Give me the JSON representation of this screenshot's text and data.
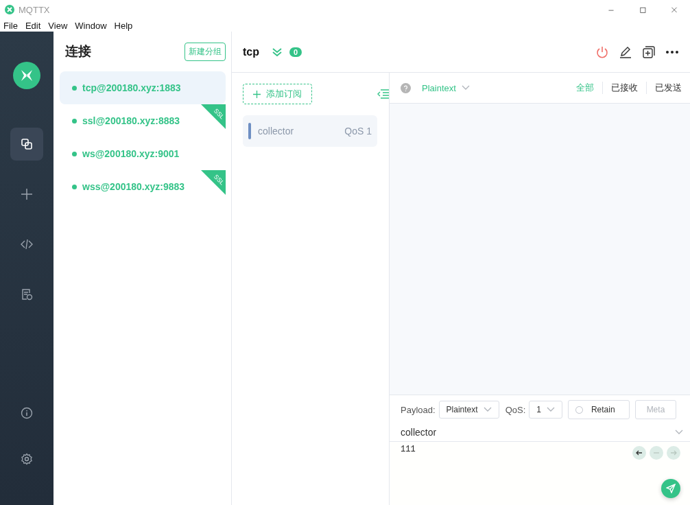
{
  "window": {
    "title": "MQTTX"
  },
  "menu": [
    "File",
    "Edit",
    "View",
    "Window",
    "Help"
  ],
  "nav": [
    {
      "selected": true
    },
    {
      "selected": false
    },
    {
      "selected": false
    },
    {
      "selected": false
    }
  ],
  "connections": {
    "title": "连接",
    "new_group_button": "新建分组",
    "items": [
      {
        "name": "tcp@200180.xyz:1883",
        "selected": true
      },
      {
        "name": "ssl@200180.xyz:8883",
        "selected": false,
        "badge": "SSL"
      },
      {
        "name": "ws@200180.xyz:9001",
        "selected": false
      },
      {
        "name": "wss@200180.xyz:9883",
        "selected": false,
        "badge": "SSL"
      }
    ]
  },
  "header": {
    "name": "tcp",
    "count": "0"
  },
  "subscriptions": {
    "add_button": "添加订阅",
    "items": [
      {
        "topic": "collector",
        "qos": "QoS 1",
        "color": "#6f8fc3"
      }
    ]
  },
  "messages": {
    "format": "Plaintext",
    "filters": [
      {
        "label": "全部",
        "selected": true
      },
      {
        "label": "已接收",
        "selected": false
      },
      {
        "label": "已发送",
        "selected": false
      }
    ]
  },
  "publish": {
    "payload_label": "Payload:",
    "payload_format": "Plaintext",
    "qos_label": "QoS:",
    "qos": "1",
    "retain": {
      "label": "Retain",
      "checked": false
    },
    "meta_button": "Meta",
    "topic": "collector",
    "payload": "111"
  }
}
